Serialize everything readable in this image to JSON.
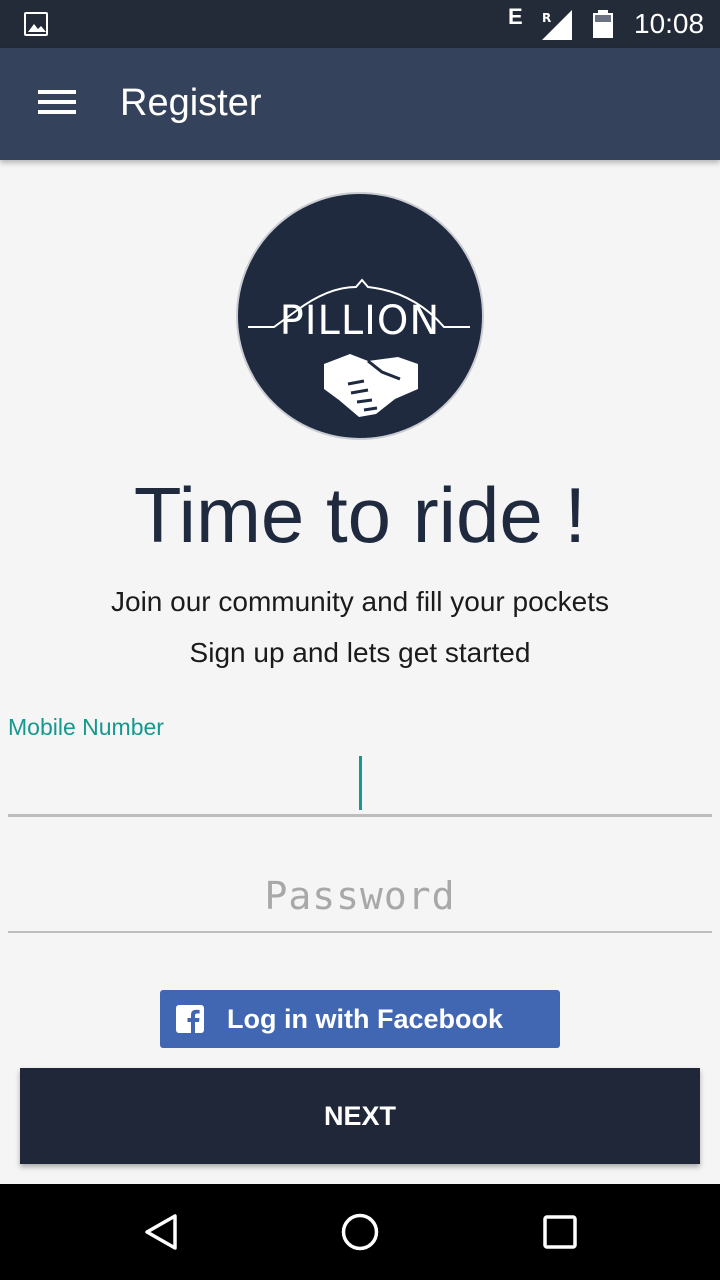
{
  "status_bar": {
    "network_type": "E",
    "roaming": "R",
    "time": "10:08",
    "icons": [
      "gallery-icon",
      "signal-icon",
      "battery-icon"
    ]
  },
  "app_bar": {
    "title": "Register",
    "menu_icon": "hamburger-menu-icon"
  },
  "logo": {
    "text": "PILLION",
    "icon": "handshake-icon"
  },
  "headline": "Time to ride !",
  "tagline": {
    "line1": "Join our community and fill your pockets",
    "line2": "Sign up and lets get started"
  },
  "form": {
    "mobile_label": "Mobile Number",
    "mobile_value": "",
    "password_placeholder": "Password",
    "password_value": ""
  },
  "facebook_button": {
    "label": "Log in with Facebook",
    "icon": "facebook-icon",
    "color": "#4267b2"
  },
  "next_button": {
    "label": "NEXT",
    "color": "#1f2738"
  },
  "colors": {
    "status_bar": "#232a38",
    "app_bar": "#34435b",
    "accent": "#17988e",
    "background": "#f5f5f5"
  },
  "nav_bar": {
    "icons": [
      "back-icon",
      "home-icon",
      "recents-icon"
    ]
  }
}
